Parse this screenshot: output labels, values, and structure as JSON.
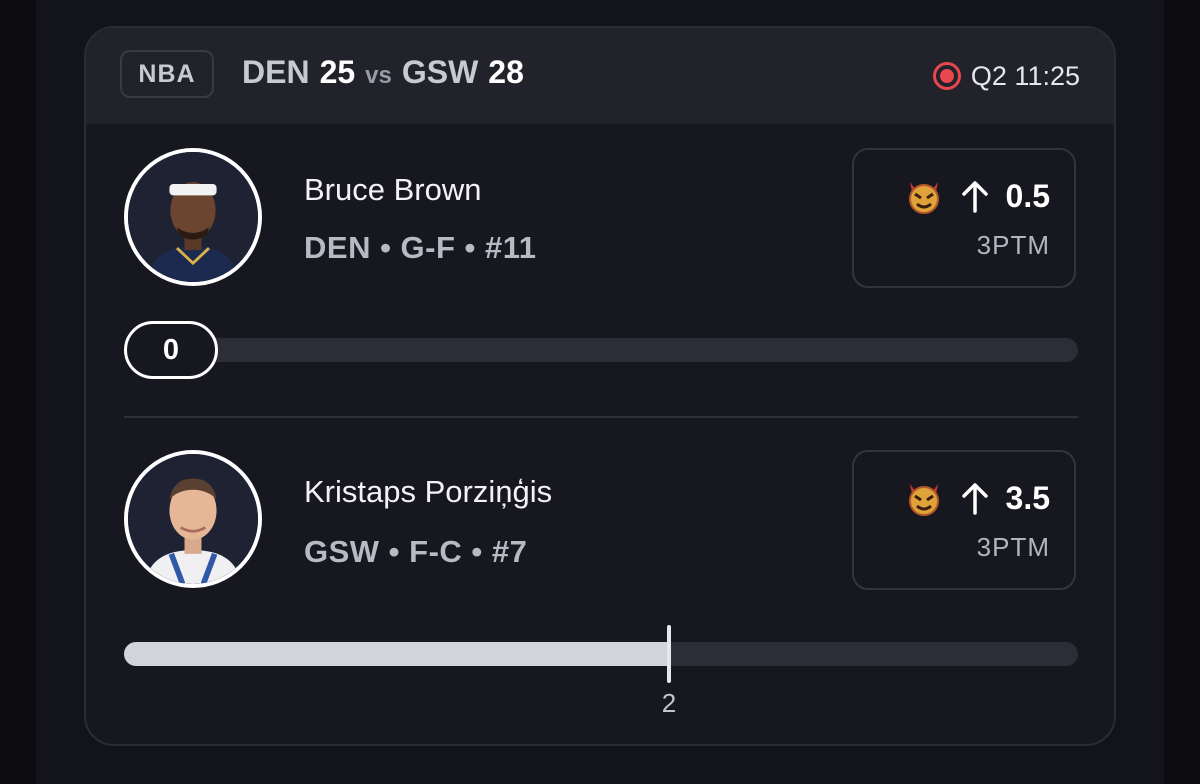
{
  "game": {
    "league": "NBA",
    "away_team": "DEN",
    "away_score": "25",
    "vs": "vs",
    "home_team": "GSW",
    "home_score": "28",
    "status": "Q2 11:25",
    "status_color": "#e8474e"
  },
  "players": [
    {
      "name": "Bruce Brown",
      "info": "DEN • G-F • #11",
      "direction": "up",
      "line": "0.5",
      "stat": "3PTM",
      "current_value": "0",
      "progress_fraction": 0
    },
    {
      "name": "Kristaps Porziņģis",
      "info": "GSW • F-C • #7",
      "direction": "up",
      "line": "3.5",
      "stat": "3PTM",
      "current_value": "2",
      "progress_fraction": 0.57
    }
  ],
  "icons": {
    "live": "live-record-icon",
    "pick": "devil-emoji-icon",
    "direction": "arrow-up-icon"
  },
  "colors": {
    "card_bg": "#171720",
    "header_bg": "#22222b",
    "track": "#2d2d37",
    "fill": "#d3d3da"
  }
}
